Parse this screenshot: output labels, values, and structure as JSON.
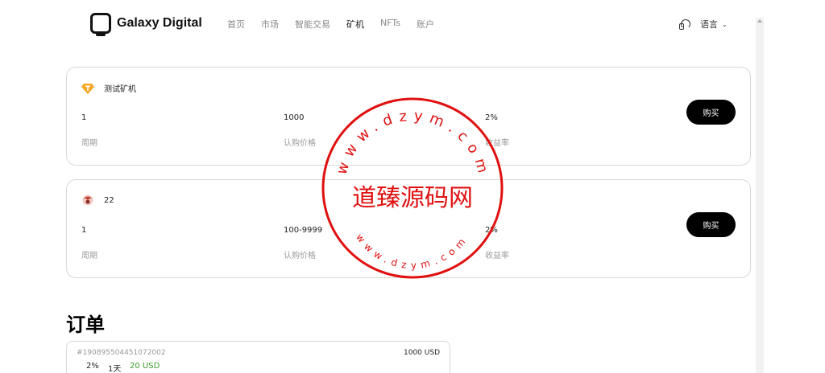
{
  "brand": {
    "name": "Galaxy Digital"
  },
  "nav": [
    {
      "label": "首页"
    },
    {
      "label": "市场"
    },
    {
      "label": "智能交易"
    },
    {
      "label": "矿机"
    },
    {
      "label": "NFTs"
    },
    {
      "label": "账户"
    }
  ],
  "header": {
    "language_label": "语言",
    "icons": [
      "headset-icon",
      "chevron-down-icon"
    ]
  },
  "miners": [
    {
      "name": "测试矿机",
      "icon": "tether-coin-icon",
      "icon_color": "#f5a623",
      "period": "1",
      "price": "1000",
      "rate": "2%",
      "period_label": "周期",
      "price_label": "认购价格",
      "rate_label": "收益率",
      "buy_label": "购买"
    },
    {
      "name": "22",
      "icon": "coin-icon",
      "icon_color": "#d0504f",
      "period": "1",
      "price": "100-9999",
      "rate": "2%",
      "period_label": "周期",
      "price_label": "认购价格",
      "rate_label": "收益率",
      "buy_label": "购买"
    }
  ],
  "orders": {
    "title": "订单",
    "items": [
      {
        "id": "#190895504451072002",
        "amount": "1000 USD",
        "rate": "2%",
        "period": "1天",
        "earning": "20 USD"
      }
    ]
  },
  "watermark": {
    "center_text": "道臻源码网",
    "top_arc": "www.dzym.com",
    "bottom_arc": "www.dzym.com",
    "color": "#e01010"
  }
}
